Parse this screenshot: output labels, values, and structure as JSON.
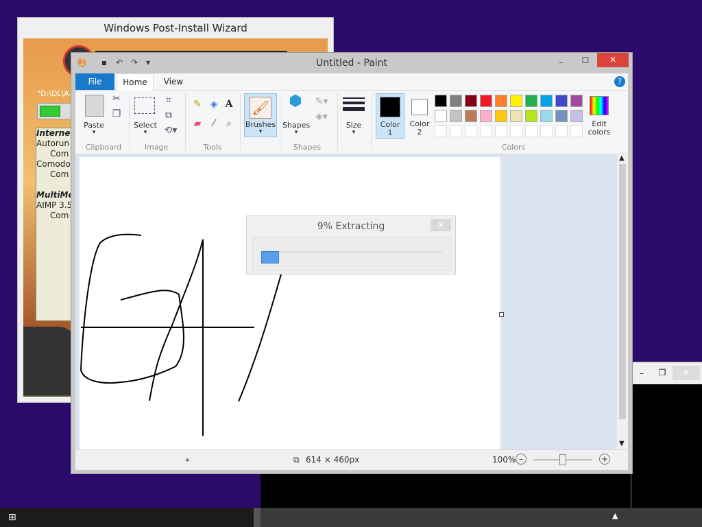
{
  "wizard": {
    "title": "Windows Post-Install Wizard",
    "path": "\"D:\\DL\\A...",
    "lines": [
      {
        "text": "Internet",
        "bold": true
      },
      {
        "text": "Autorun",
        "bold": false
      },
      {
        "text": "   Com",
        "bold": false
      },
      {
        "text": "Comodo",
        "bold": false
      },
      {
        "text": "   Com",
        "bold": false
      },
      {
        "text": "",
        "bold": false
      },
      {
        "text": "MultiMe",
        "bold": true
      },
      {
        "text": "AIMP 3.5",
        "bold": false
      },
      {
        "text": "   Com",
        "bold": false
      }
    ]
  },
  "paint": {
    "title": "Untitled - Paint",
    "tabs": {
      "file": "File",
      "home": "Home",
      "view": "View"
    },
    "clipboard": {
      "paste": "Paste",
      "label": "Clipboard"
    },
    "image": {
      "select": "Select",
      "label": "Image"
    },
    "tools": {
      "label": "Tools"
    },
    "brushes": {
      "label": "Brushes"
    },
    "shapes": {
      "shapes": "Shapes",
      "label": "Shapes"
    },
    "size": {
      "label": "Size"
    },
    "color1": {
      "line1": "Color",
      "line2": "1"
    },
    "color2": {
      "line1": "Color",
      "line2": "2"
    },
    "colors": {
      "label": "Colors",
      "edit_line1": "Edit",
      "edit_line2": "colors"
    },
    "palette_row1": [
      "#000000",
      "#7f7f7f",
      "#880015",
      "#ed1c24",
      "#ff7f27",
      "#fff200",
      "#22b14c",
      "#00a2e8",
      "#3f48cc",
      "#a349a4"
    ],
    "palette_row2": [
      "#ffffff",
      "#c3c3c3",
      "#b97a57",
      "#ffaec9",
      "#ffc90e",
      "#efe4b0",
      "#b5e61d",
      "#99d9ea",
      "#7092be",
      "#c8bfe7"
    ],
    "status": {
      "dimensions": "614 × 460px",
      "zoom": "100%"
    }
  },
  "extract_dialog": {
    "title": "9% Extracting",
    "progress": 0.09
  }
}
